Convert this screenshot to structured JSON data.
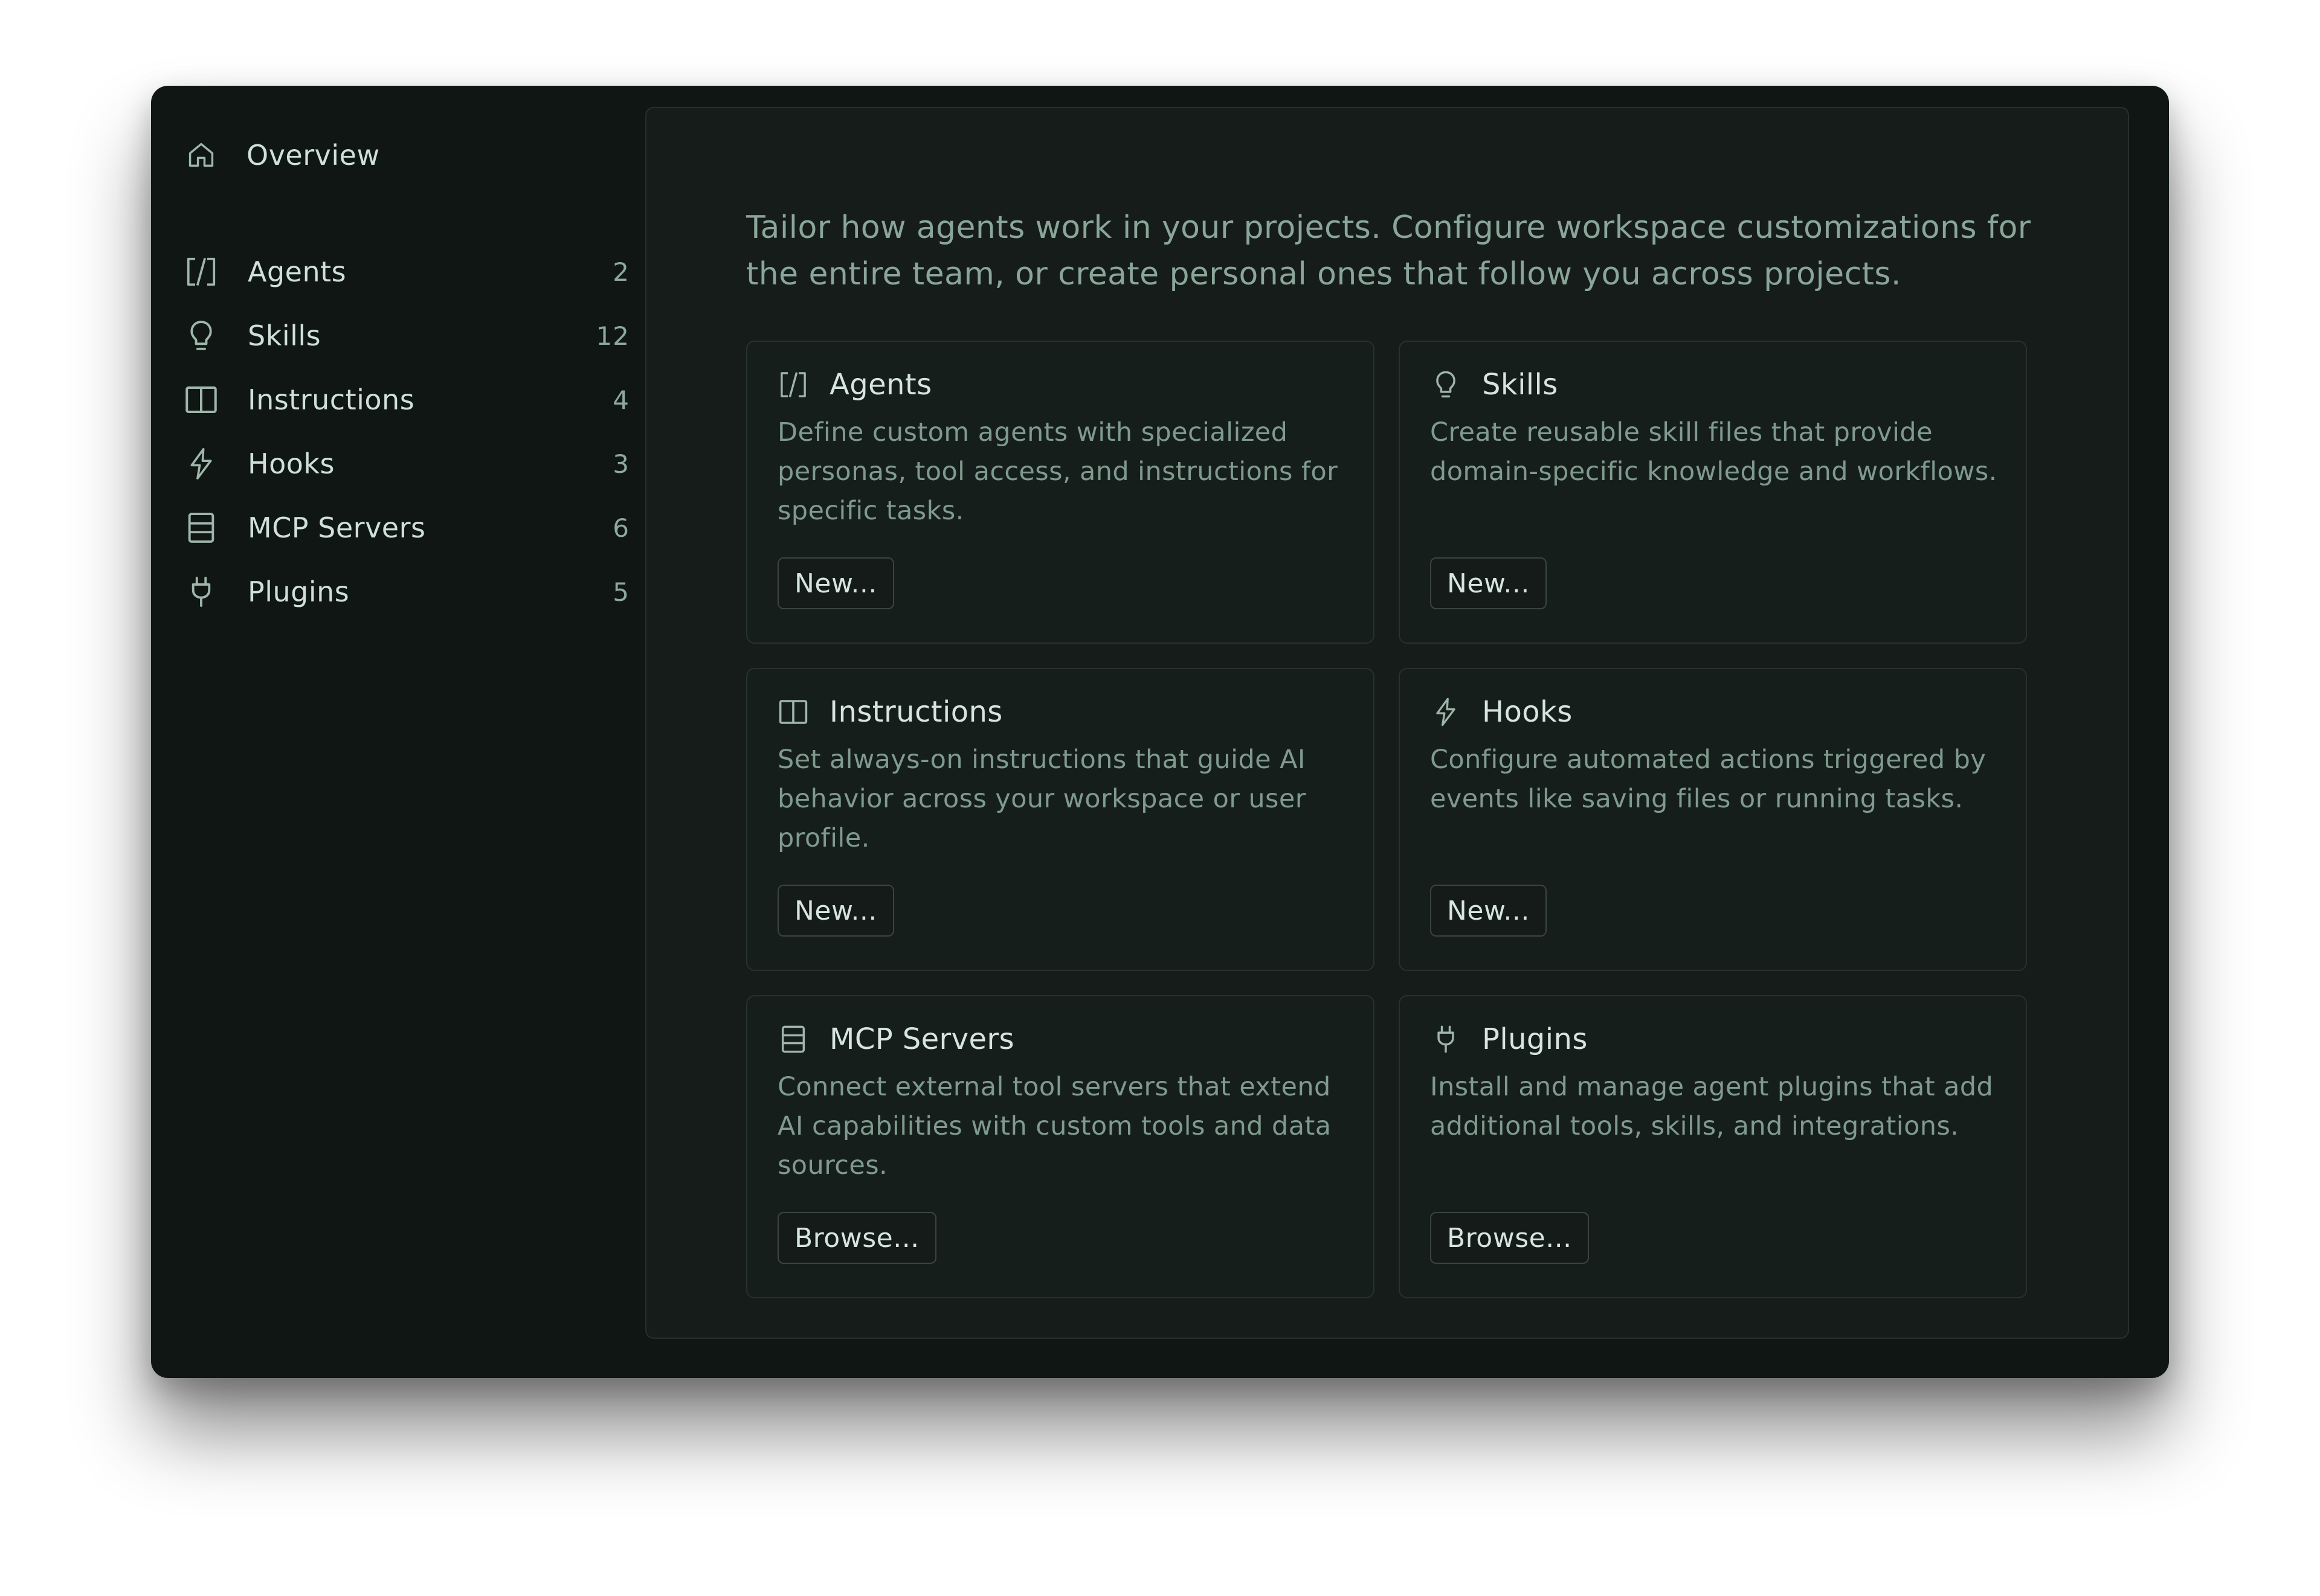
{
  "sidebar": {
    "overview": {
      "label": "Overview",
      "icon": "home-icon"
    },
    "items": [
      {
        "label": "Agents",
        "count": "2",
        "icon": "agents-icon"
      },
      {
        "label": "Skills",
        "count": "12",
        "icon": "lightbulb-icon"
      },
      {
        "label": "Instructions",
        "count": "4",
        "icon": "book-icon"
      },
      {
        "label": "Hooks",
        "count": "3",
        "icon": "lightning-icon"
      },
      {
        "label": "MCP Servers",
        "count": "6",
        "icon": "server-icon"
      },
      {
        "label": "Plugins",
        "count": "5",
        "icon": "plug-icon"
      }
    ]
  },
  "main": {
    "intro": "Tailor how agents work in your projects. Configure workspace customizations for the entire team, or create personal ones that follow you across projects.",
    "cards": [
      {
        "title": "Agents",
        "icon": "agents-icon",
        "description": "Define custom agents with specialized personas, tool access, and instructions for specific tasks.",
        "button": "New..."
      },
      {
        "title": "Skills",
        "icon": "lightbulb-icon",
        "description": "Create reusable skill files that provide domain-specific knowledge and workflows.",
        "button": "New..."
      },
      {
        "title": "Instructions",
        "icon": "book-icon",
        "description": "Set always-on instructions that guide AI behavior across your workspace or user profile.",
        "button": "New..."
      },
      {
        "title": "Hooks",
        "icon": "lightning-icon",
        "description": "Configure automated actions triggered by events like saving files or running tasks.",
        "button": "New..."
      },
      {
        "title": "MCP Servers",
        "icon": "server-icon",
        "description": "Connect external tool servers that extend AI capabilities with custom tools and data sources.",
        "button": "Browse..."
      },
      {
        "title": "Plugins",
        "icon": "plug-icon",
        "description": "Install and manage agent plugins that add additional tools, skills, and integrations.",
        "button": "Browse..."
      }
    ]
  },
  "colors": {
    "window_bg": "#0f1614",
    "panel_bg": "#151c1a",
    "text_primary": "#cfe0d8",
    "text_muted": "#7f9a8e"
  }
}
